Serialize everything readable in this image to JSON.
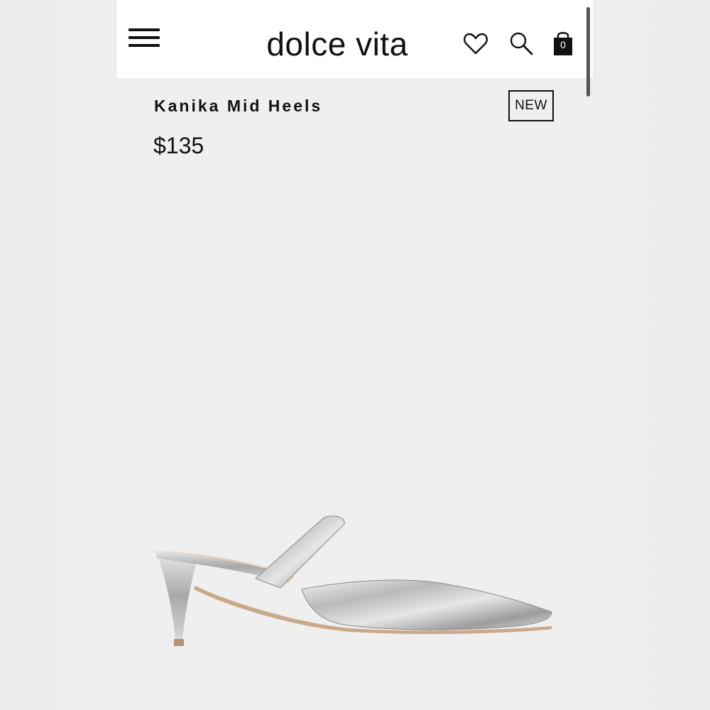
{
  "header": {
    "brand": "dolce vita",
    "icons": [
      "menu-icon",
      "heart-icon",
      "search-icon",
      "shopping-bag-icon"
    ],
    "cart_count": "0"
  },
  "product": {
    "name": "Kanika Mid Heels",
    "badge": "NEW",
    "price": "$135",
    "image": "silver-metallic-pointed-mule-heel"
  },
  "colors": {
    "header_bg": "#ffffff",
    "page_bg": "#efefef",
    "text": "#111111",
    "metal": "#c9c9c9"
  }
}
